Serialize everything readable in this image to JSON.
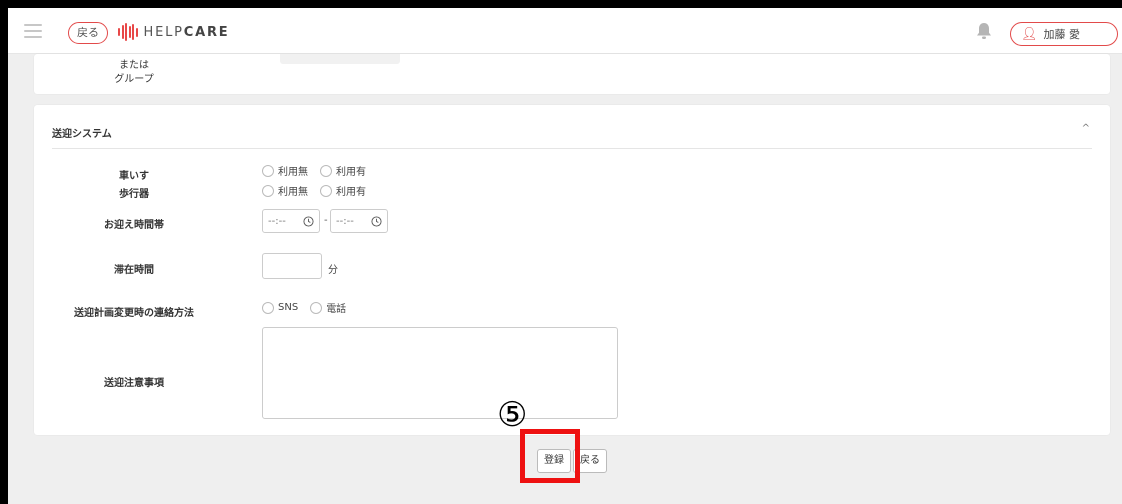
{
  "header": {
    "back_label": "戻る",
    "logo_text_bold": "HELP",
    "logo_text_rest": "CARE",
    "user_name": "加藤 愛",
    "icons": {
      "menu": "hamburger-icon",
      "bell": "bell-icon",
      "user": "person-icon"
    },
    "accent_color": "#e24a4a"
  },
  "top_card": {
    "label_line1": "または",
    "label_line2": "グループ"
  },
  "section": {
    "title": "送迎システム",
    "collapse_icon": "^",
    "wheelchair": {
      "label": "車いす",
      "options": [
        "利用無",
        "利用有"
      ]
    },
    "walker": {
      "label": "歩行器",
      "options": [
        "利用無",
        "利用有"
      ]
    },
    "pickup_time": {
      "label": "お迎え時間帯",
      "from_placeholder": "--:--",
      "to_placeholder": "--:--",
      "separator": "-"
    },
    "stay_time": {
      "label": "滞在時間",
      "unit": "分"
    },
    "contact_method": {
      "label": "送迎計画変更時の連絡方法",
      "options": [
        "SNS",
        "電話"
      ]
    },
    "notes": {
      "label": "送迎注意事項"
    }
  },
  "footer": {
    "register_label": "登録",
    "back_label": "戻る"
  },
  "annotation": {
    "step_marker": "⑤",
    "highlight_color": "#ee1111"
  }
}
